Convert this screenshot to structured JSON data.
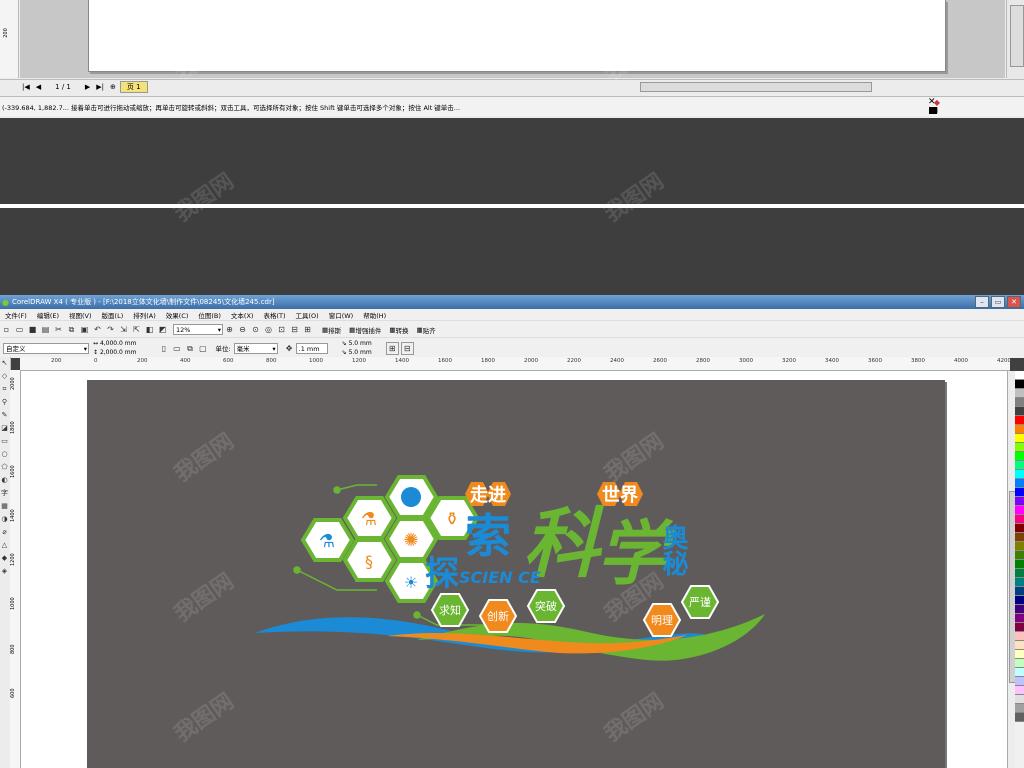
{
  "top_window": {
    "page_nav": {
      "first": "|◀",
      "prev": "◀",
      "counter": "1 / 1",
      "next": "▶",
      "last": "▶|",
      "add": "⊕",
      "page_tab": "页 1"
    },
    "status": "(-339.684, 1,882.7...   接着单击可进行拖动或缩放；再单击可旋转或斜斜；双击工具，可选择所有对象；按住 Shift 键单击可选择多个对象；按住 Alt 键单击...",
    "ruler_label": "200"
  },
  "main_window": {
    "title": "CorelDRAW X4 ( 专业版 ) - [F:\\2018立体文化墙\\制作文件\\08245\\文化墙245.cdr]",
    "menu": [
      "文件(F)",
      "编辑(E)",
      "视图(V)",
      "版面(L)",
      "排列(A)",
      "效果(C)",
      "位图(B)",
      "文本(X)",
      "表格(T)",
      "工具(O)",
      "窗口(W)",
      "帮助(H)"
    ],
    "toolbar1": {
      "zoom": "12%",
      "plugins": [
        "排斯",
        "增强插件",
        "转换",
        "贴齐"
      ]
    },
    "toolbar2": {
      "page_preset": "自定义",
      "width": "4,000.0 mm",
      "height": "2,000.0 mm",
      "unit_label": "单位:",
      "unit": "毫米",
      "nudge": ".1 mm",
      "dup_x": "5.0 mm",
      "dup_y": "5.0 mm"
    },
    "ruler_ticks": [
      "400",
      "200",
      "0",
      "200",
      "400",
      "600",
      "800",
      "1000",
      "1200",
      "1400",
      "1600",
      "1800",
      "2000",
      "2200",
      "2400",
      "2600",
      "2800",
      "3000",
      "3200",
      "3400",
      "3600",
      "3800",
      "4000",
      "4200"
    ],
    "vruler_ticks": [
      "2000",
      "1800",
      "1600",
      "1400",
      "1200",
      "1000",
      "800",
      "600"
    ]
  },
  "artwork": {
    "title_top_left": "走进",
    "title_top_right": "世界",
    "vertical_left": "探",
    "word_suo": "索",
    "word_ke": "科",
    "word_xue": "学",
    "vertical_right": "奥秘",
    "english": "SCIEN  CE",
    "badges": [
      "求知",
      "创新",
      "突破",
      "明理",
      "严谨"
    ],
    "colors": {
      "green": "#6ab632",
      "orange": "#f08a1c",
      "blue": "#1b8bd6",
      "canvas": "#5f5b5b"
    }
  },
  "watermark": "我图网"
}
